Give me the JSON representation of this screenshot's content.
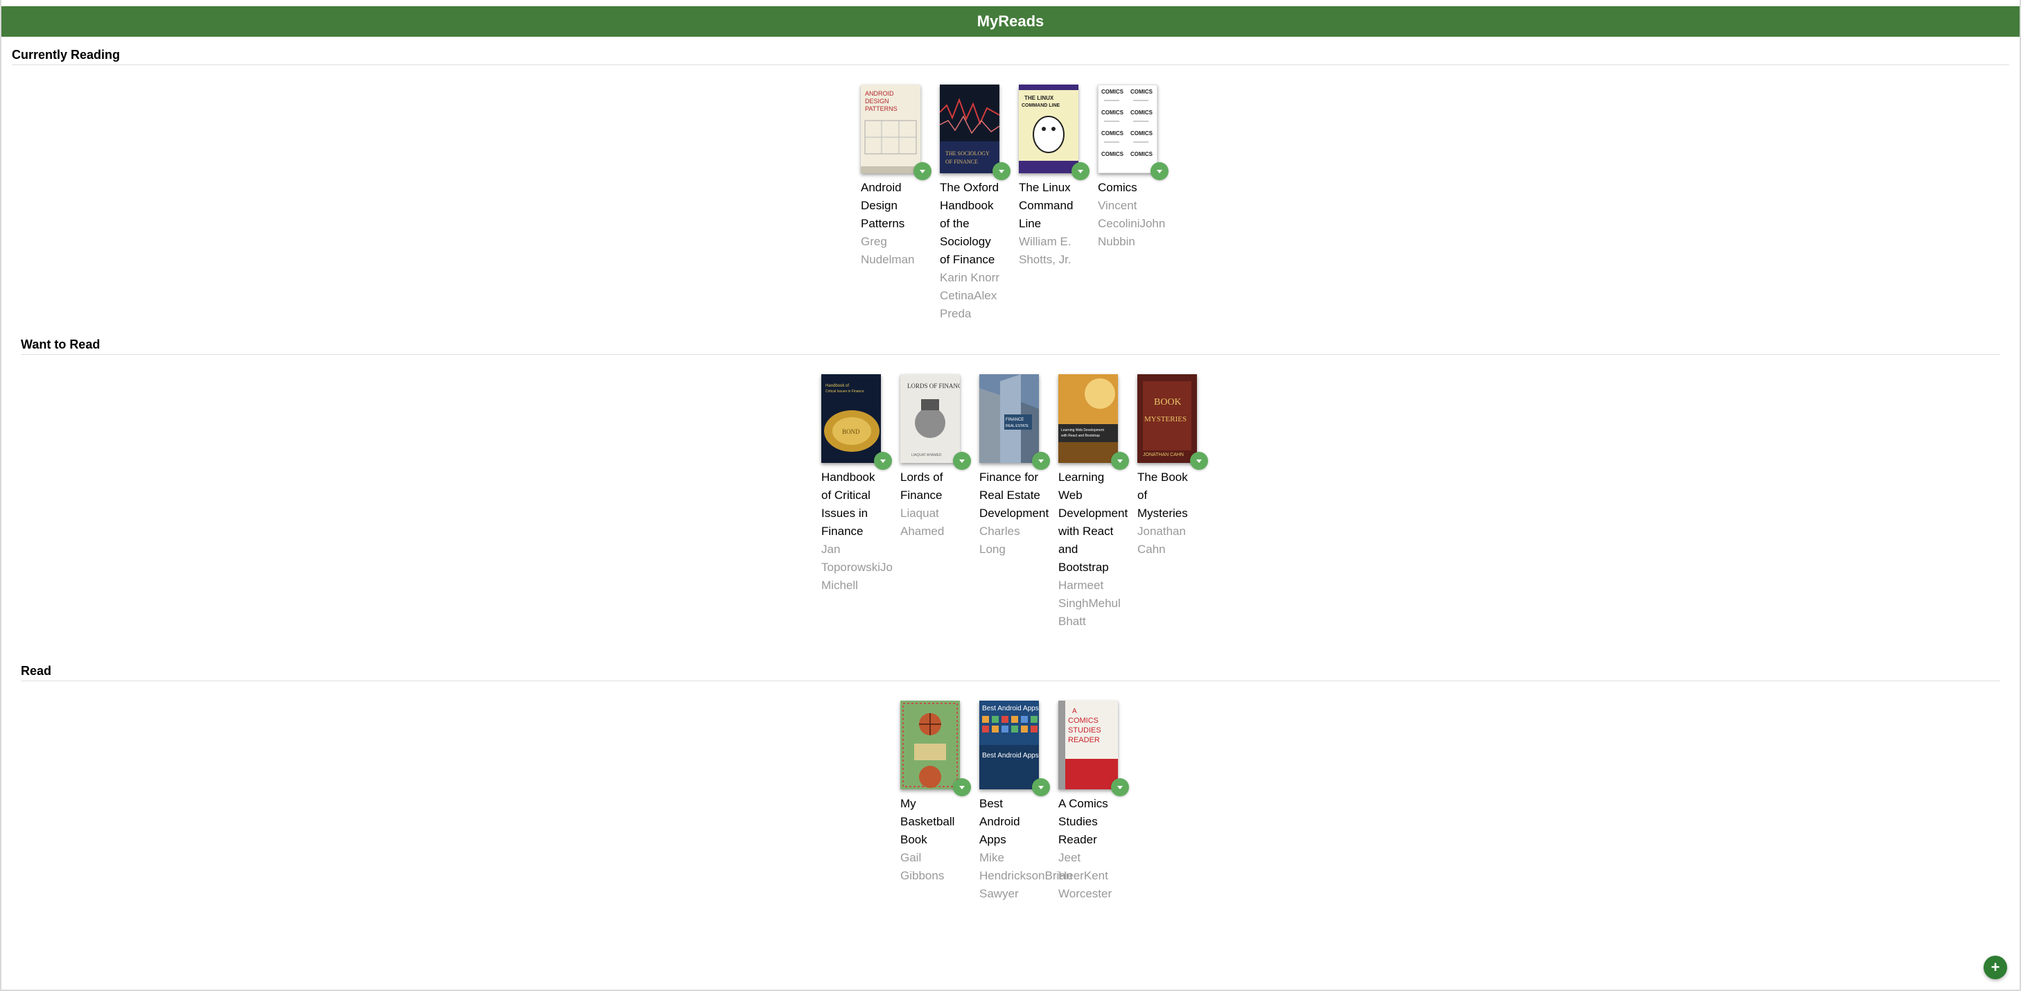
{
  "app": {
    "title": "MyReads"
  },
  "shelves": [
    {
      "title": "Currently Reading",
      "books": [
        {
          "title": "Android Design Patterns",
          "authors": "Greg Nudelman",
          "cover": "adp"
        },
        {
          "title": "The Oxford Handbook of the Sociology of Finance",
          "authors": "Karin Knorr CetinaAlex Preda",
          "cover": "oxf"
        },
        {
          "title": "The Linux Command Line",
          "authors": "William E. Shotts, Jr.",
          "cover": "lin"
        },
        {
          "title": "Comics",
          "authors": "Vincent CecoliniJohn Nubbin",
          "cover": "com"
        }
      ]
    },
    {
      "title": "Want to Read",
      "books": [
        {
          "title": "Handbook of Critical Issues in Finance",
          "authors": "Jan ToporowskiJo Michell",
          "cover": "hci"
        },
        {
          "title": "Lords of Finance",
          "authors": "Liaquat Ahamed",
          "cover": "lof"
        },
        {
          "title": "Finance for Real Estate Development",
          "authors": "Charles Long",
          "cover": "fre"
        },
        {
          "title": "Learning Web Development with React and Bootstrap",
          "authors": "Harmeet SinghMehul Bhatt",
          "cover": "lwd"
        },
        {
          "title": "The Book of Mysteries",
          "authors": "Jonathan Cahn",
          "cover": "bom"
        }
      ]
    },
    {
      "title": "Read",
      "books": [
        {
          "title": "My Basketball Book",
          "authors": "Gail Gibbons",
          "cover": "mbb"
        },
        {
          "title": "Best Android Apps",
          "authors": "Mike HendricksonBrian Sawyer",
          "cover": "baa"
        },
        {
          "title": "A Comics Studies Reader",
          "authors": "Jeet HeerKent Worcester",
          "cover": "csr"
        }
      ]
    }
  ],
  "add_button": {
    "label": "+"
  },
  "colors": {
    "header": "#447c3b",
    "shelf_changer": "#60ac5d",
    "add_button": "#2e7d32",
    "author_text": "#999999"
  }
}
